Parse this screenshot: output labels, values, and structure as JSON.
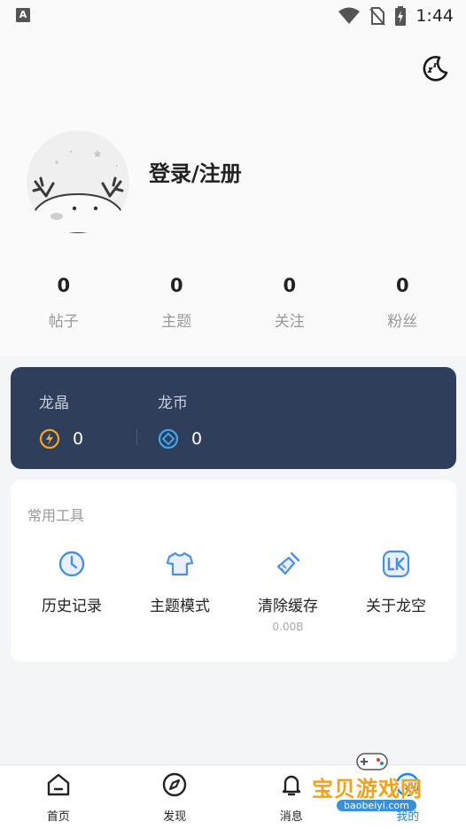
{
  "status_bar": {
    "time": "1:44",
    "notification_icon_letter": "A"
  },
  "header": {
    "theme_toggle_icon": "moon-icon"
  },
  "profile": {
    "login_label": "登录/注册",
    "avatar_icon": "dragon-avatar-icon"
  },
  "stats": [
    {
      "value": "0",
      "label": "帖子"
    },
    {
      "value": "0",
      "label": "主题"
    },
    {
      "value": "0",
      "label": "关注"
    },
    {
      "value": "0",
      "label": "粉丝"
    }
  ],
  "wallet": {
    "items": [
      {
        "label": "龙晶",
        "value": "0",
        "icon": "crystal-icon",
        "color": "#f5a623"
      },
      {
        "label": "龙币",
        "value": "0",
        "icon": "coin-icon",
        "color": "#3fa6e8"
      }
    ],
    "background": "#2e3e5b"
  },
  "tools": {
    "title": "常用工具",
    "items": [
      {
        "label": "历史记录",
        "sub": "",
        "icon": "clock-icon"
      },
      {
        "label": "主题模式",
        "sub": "",
        "icon": "shirt-icon"
      },
      {
        "label": "清除缓存",
        "sub": "0.00B",
        "icon": "broom-icon"
      },
      {
        "label": "关于龙空",
        "sub": "",
        "icon": "lk-logo-icon"
      }
    ],
    "icon_color": "#4a8fe0"
  },
  "tabbar": {
    "tabs": [
      {
        "label": "首页",
        "icon": "home-icon",
        "active": false
      },
      {
        "label": "发现",
        "icon": "compass-icon",
        "active": false
      },
      {
        "label": "消息",
        "icon": "bell-icon",
        "active": false
      },
      {
        "label": "我的",
        "icon": "profile-icon",
        "active": true
      }
    ],
    "active_color": "#1e88e5"
  },
  "watermark": {
    "text": "宝贝游戏网",
    "sub": "baobeiyi.com"
  }
}
